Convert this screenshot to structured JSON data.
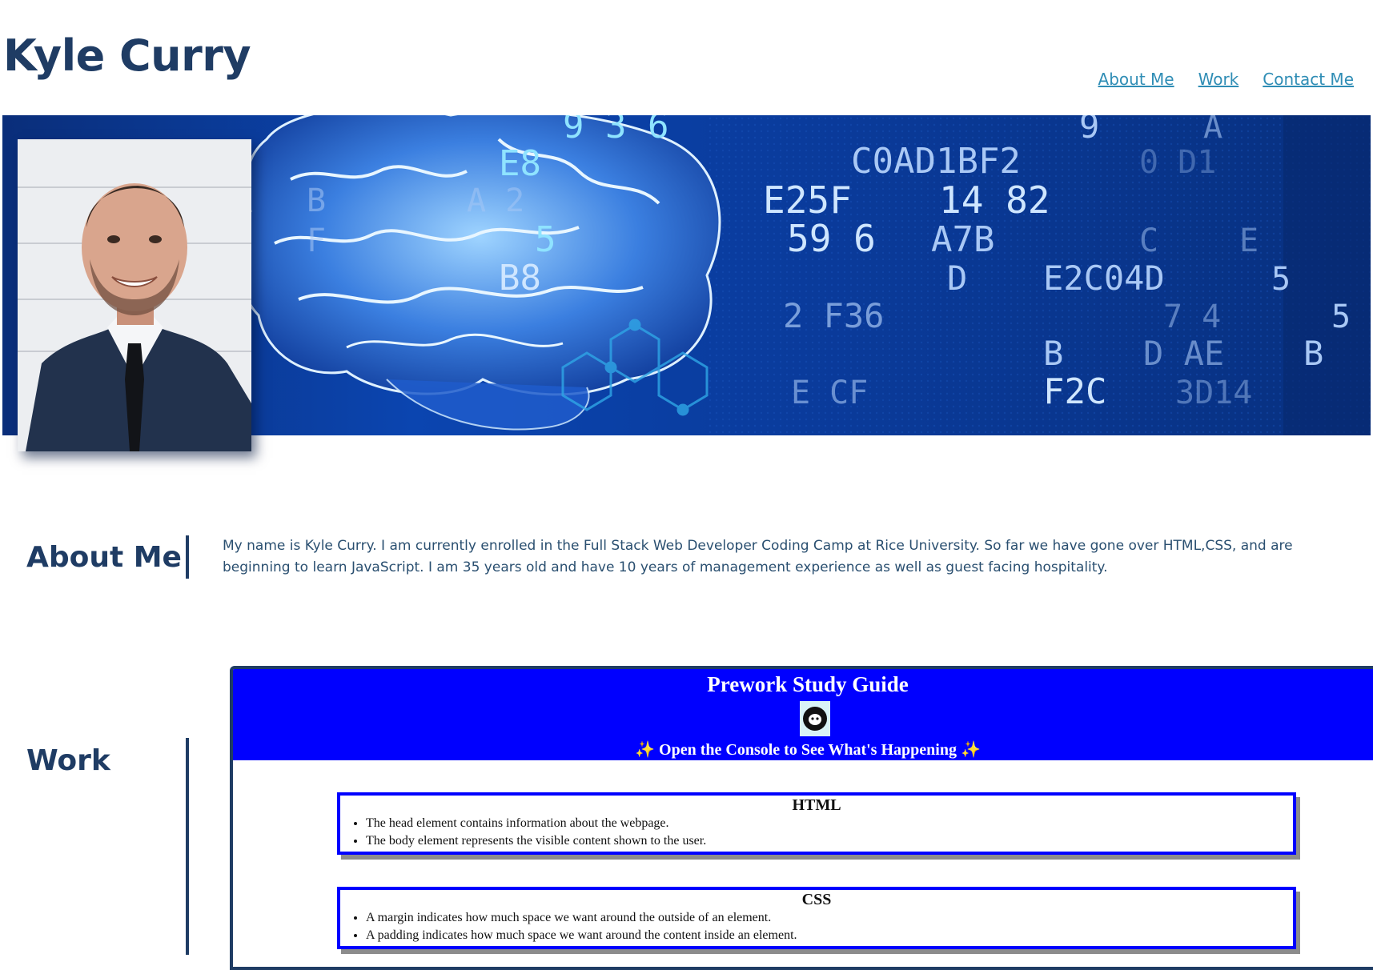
{
  "header": {
    "title": "Kyle Curry",
    "nav": [
      {
        "label": "About Me"
      },
      {
        "label": "Work"
      },
      {
        "label": "Contact Me"
      }
    ]
  },
  "hero": {
    "background": "brain-circuit-banner",
    "digits": [
      "9 3 6",
      "9",
      "A",
      "E8",
      "C0AD1BF2",
      "0 D1",
      "B",
      "A 2",
      "E25F",
      "14 82",
      "F",
      "5",
      "59 6",
      "A7B",
      "C",
      "E",
      "B8",
      "D",
      "E2C04D",
      "5",
      "2 F36",
      "7 4",
      "5",
      "B",
      "D AE",
      "B",
      "E CF",
      "F2C",
      "3D14"
    ],
    "portrait": "profile-photo"
  },
  "about": {
    "heading": "About Me",
    "text": "My name is Kyle Curry. I am currently enrolled in the Full Stack Web Developer Coding Camp at Rice University. So far we have gone over HTML,CSS, and are beginning to learn JavaScript. I am 35 years old and have 10 years of management experience as well as guest facing hospitality."
  },
  "work": {
    "heading": "Work",
    "project": {
      "title": "Prework Study Guide",
      "logo": "octocat-logo",
      "subtitle": "✨ Open the Console to See What's Happening ✨",
      "cards": [
        {
          "heading": "HTML",
          "items": [
            "The head element contains information about the webpage.",
            "The body element represents the visible content shown to the user."
          ]
        },
        {
          "heading": "CSS",
          "items": [
            "A margin indicates how much space we want around the outside of an element.",
            "A padding indicates how much space we want around the content inside an element."
          ]
        }
      ]
    }
  },
  "colors": {
    "heading": "#1f3c64",
    "nav_link": "#2f8db5",
    "body_text": "#2a4f70",
    "project_blue": "#0000ff"
  }
}
